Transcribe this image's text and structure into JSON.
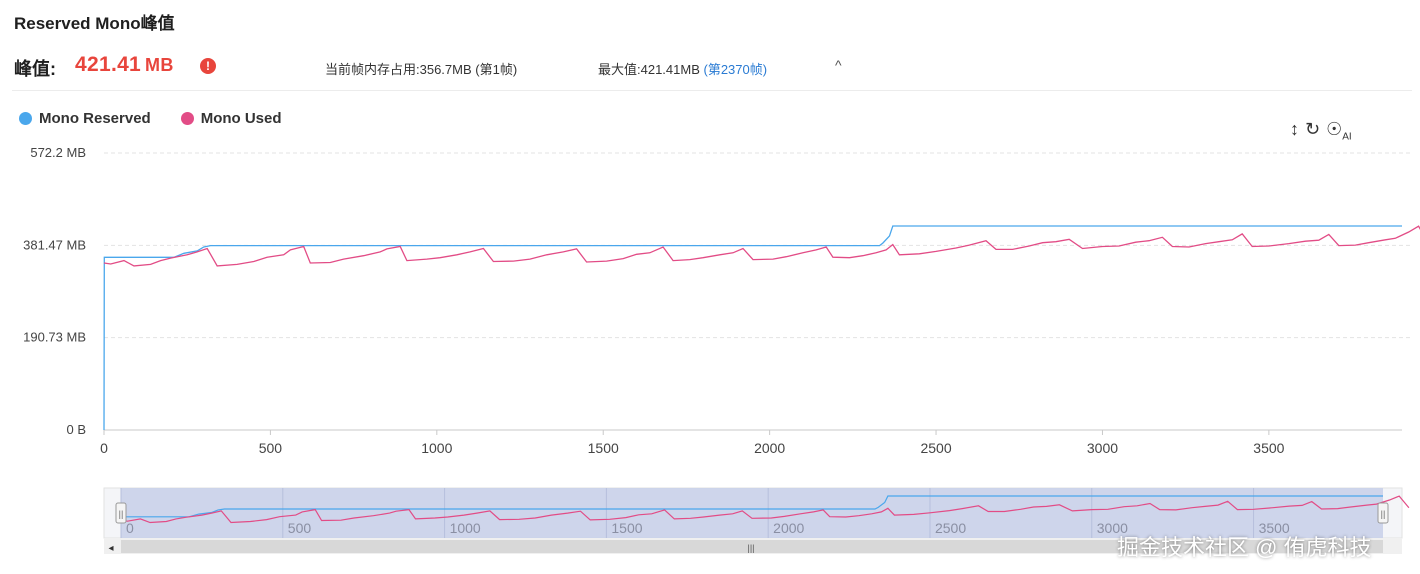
{
  "header": {
    "title": "Reserved Mono峰值",
    "peak_label": "峰值:",
    "peak_value": "421.41",
    "peak_unit": "MB",
    "alert_glyph": "!",
    "current_text": "当前帧内存占用:356.7MB (第1帧)",
    "max_text": "最大值:421.41MB ",
    "max_link": "(第2370帧)",
    "collapse_glyph": "^"
  },
  "legend": [
    {
      "label": "Mono Reserved",
      "color": "#4aa7ec"
    },
    {
      "label": "Mono Used",
      "color": "#e24c86"
    }
  ],
  "toolbar": {
    "resize_icon": "↕",
    "refresh_icon": "↻",
    "ai_icon": "☉",
    "ai_text": "AI"
  },
  "chart_data": {
    "type": "line",
    "xlim": [
      0,
      3900
    ],
    "ylim": [
      0,
      572.2
    ],
    "x_ticks": [
      0,
      500,
      1000,
      1500,
      2000,
      2500,
      3000,
      3500
    ],
    "y_ticks": [
      {
        "value": 0,
        "label": "0 B"
      },
      {
        "value": 190.73,
        "label": "190.73 MB"
      },
      {
        "value": 381.47,
        "label": "381.47 MB"
      },
      {
        "value": 572.2,
        "label": "572.2 MB"
      }
    ],
    "grid": "horizontal-dashed",
    "legend_position": "top-left",
    "series": [
      {
        "name": "Mono Reserved",
        "color": "#4aa7ec",
        "points": [
          [
            0,
            0
          ],
          [
            1,
            356.7
          ],
          [
            210,
            356.7
          ],
          [
            240,
            365
          ],
          [
            280,
            370
          ],
          [
            300,
            378
          ],
          [
            320,
            381
          ],
          [
            2330,
            381
          ],
          [
            2340,
            386
          ],
          [
            2360,
            401
          ],
          [
            2370,
            421.41
          ],
          [
            3900,
            421.41
          ]
        ]
      },
      {
        "name": "Mono Used",
        "color": "#e24c86",
        "points": [
          [
            0,
            345
          ],
          [
            20,
            343
          ],
          [
            60,
            350
          ],
          [
            90,
            339
          ],
          [
            140,
            342
          ],
          [
            170,
            350
          ],
          [
            200,
            355
          ],
          [
            250,
            362
          ],
          [
            280,
            368
          ],
          [
            310,
            375
          ],
          [
            340,
            339
          ],
          [
            400,
            342
          ],
          [
            450,
            348
          ],
          [
            490,
            357
          ],
          [
            540,
            362
          ],
          [
            560,
            372
          ],
          [
            600,
            379
          ],
          [
            620,
            345
          ],
          [
            680,
            346
          ],
          [
            720,
            353
          ],
          [
            780,
            360
          ],
          [
            830,
            368
          ],
          [
            850,
            374
          ],
          [
            890,
            379
          ],
          [
            910,
            350
          ],
          [
            970,
            353
          ],
          [
            1010,
            356
          ],
          [
            1060,
            362
          ],
          [
            1100,
            368
          ],
          [
            1140,
            375
          ],
          [
            1170,
            348
          ],
          [
            1230,
            349
          ],
          [
            1280,
            353
          ],
          [
            1330,
            362
          ],
          [
            1380,
            368
          ],
          [
            1420,
            374
          ],
          [
            1450,
            347
          ],
          [
            1510,
            349
          ],
          [
            1560,
            354
          ],
          [
            1600,
            363
          ],
          [
            1640,
            366
          ],
          [
            1680,
            378
          ],
          [
            1710,
            350
          ],
          [
            1760,
            352
          ],
          [
            1800,
            356
          ],
          [
            1850,
            362
          ],
          [
            1890,
            366
          ],
          [
            1920,
            375
          ],
          [
            1950,
            352
          ],
          [
            2010,
            353
          ],
          [
            2050,
            358
          ],
          [
            2100,
            366
          ],
          [
            2140,
            372
          ],
          [
            2170,
            378
          ],
          [
            2190,
            357
          ],
          [
            2240,
            356
          ],
          [
            2280,
            360
          ],
          [
            2320,
            366
          ],
          [
            2350,
            372
          ],
          [
            2370,
            383
          ],
          [
            2390,
            362
          ],
          [
            2450,
            364
          ],
          [
            2500,
            369
          ],
          [
            2560,
            376
          ],
          [
            2600,
            382
          ],
          [
            2650,
            391
          ],
          [
            2680,
            373
          ],
          [
            2730,
            373
          ],
          [
            2780,
            380
          ],
          [
            2820,
            387
          ],
          [
            2860,
            389
          ],
          [
            2900,
            394
          ],
          [
            2940,
            375
          ],
          [
            3000,
            379
          ],
          [
            3050,
            380
          ],
          [
            3100,
            388
          ],
          [
            3140,
            391
          ],
          [
            3180,
            398
          ],
          [
            3210,
            379
          ],
          [
            3260,
            378
          ],
          [
            3310,
            385
          ],
          [
            3350,
            389
          ],
          [
            3390,
            393
          ],
          [
            3420,
            405
          ],
          [
            3450,
            379
          ],
          [
            3500,
            380
          ],
          [
            3560,
            385
          ],
          [
            3610,
            390
          ],
          [
            3650,
            392
          ],
          [
            3680,
            404
          ],
          [
            3710,
            381
          ],
          [
            3760,
            382
          ],
          [
            3800,
            387
          ],
          [
            3850,
            393
          ],
          [
            3880,
            396
          ],
          [
            3920,
            409
          ],
          [
            3950,
            421
          ],
          [
            3980,
            385
          ]
        ]
      }
    ]
  },
  "navigator": {
    "x_ticks": [
      0,
      500,
      1000,
      1500,
      2000,
      2500,
      3000,
      3500
    ],
    "handle_glyph": "||",
    "scroll_left": "◂",
    "scroll_thumb": "|||"
  },
  "watermark": "掘金技术社区 @ 侑虎科技"
}
